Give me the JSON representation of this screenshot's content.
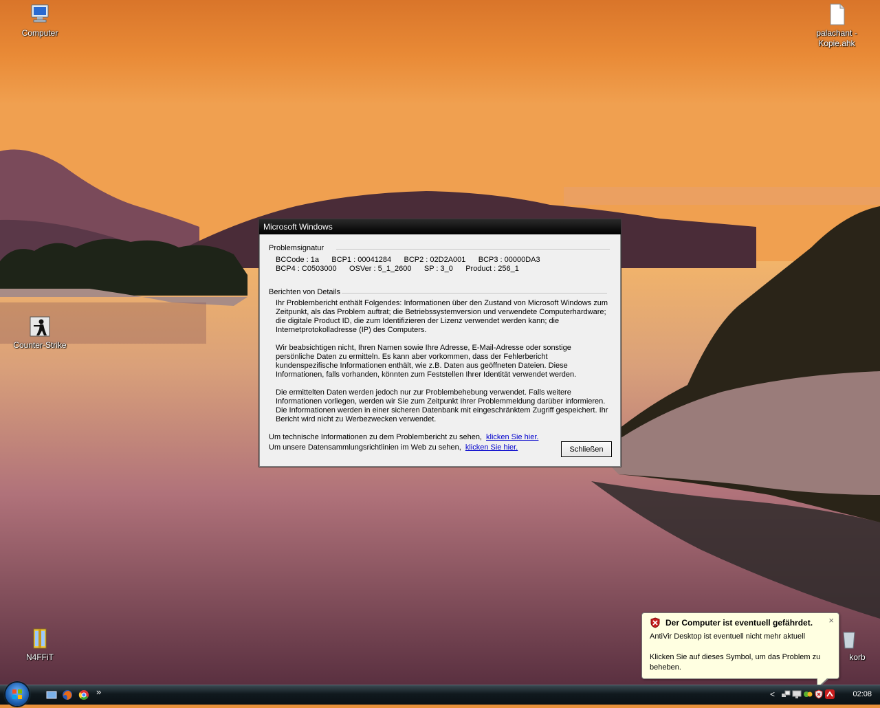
{
  "desktop": {
    "icons": [
      {
        "label": "Computer"
      },
      {
        "label": "palachant - Kopie.ahk"
      },
      {
        "label": "Counter-Strike"
      },
      {
        "label": "N4FFiT"
      },
      {
        "label": "korb"
      }
    ]
  },
  "dialog": {
    "title": "Microsoft Windows",
    "problem_signature": {
      "heading": "Problemsignatur",
      "line1": "BCCode : 1a      BCP1 : 00041284      BCP2 : 02D2A001      BCP3 : 00000DA3",
      "line2": "BCP4 : C0503000      OSVer : 5_1_2600      SP : 3_0      Product : 256_1"
    },
    "details": {
      "heading": "Berichten von Details",
      "para1": "Ihr Problembericht enthält Folgendes: Informationen über den Zustand von Microsoft Windows zum Zeitpunkt, als das Problem auftrat; die Betriebssystemversion und verwendete Computerhardware; die digitale Product ID, die zum Identifizieren der Lizenz verwendet werden kann; die Internetprotokolladresse (IP) des Computers.",
      "para2": "Wir beabsichtigen nicht, Ihren Namen sowie Ihre Adresse, E-Mail-Adresse oder sonstige persönliche Daten zu ermitteln. Es kann aber vorkommen, dass der Fehlerbericht kundenspezifische Informationen enthält, wie z.B. Daten aus geöffneten Dateien. Diese Informationen, falls vorhanden, könnten zum Feststellen Ihrer Identität verwendet werden.",
      "para3": "Die ermittelten Daten werden jedoch nur zur Problembehebung verwendet. Falls weitere Informationen vorliegen, werden wir Sie zum Zeitpunkt Ihrer Problemmeldung darüber informieren. Die Informationen werden in einer sicheren Datenbank mit eingeschränktem Zugriff gespeichert. Ihr Bericht wird nicht zu Werbezwecken verwendet."
    },
    "tech_info_text": "Um technische Informationen zu dem Problembericht zu sehen,",
    "tech_info_link": "klicken Sie hier.",
    "privacy_text": "Um unsere Datensammlungsrichtlinien im Web zu sehen,",
    "privacy_link": "klicken Sie hier.",
    "close_label": "Schließen"
  },
  "balloon": {
    "title": "Der Computer ist eventuell gefährdet.",
    "line1": "AntiVir Desktop ist eventuell nicht mehr aktuell",
    "line2": "Klicken Sie auf dieses Symbol, um das Problem zu beheben.",
    "close_glyph": "×"
  },
  "taskbar": {
    "overflow_glyph": "»",
    "tray_chevron": "<",
    "clock": "02:08"
  }
}
